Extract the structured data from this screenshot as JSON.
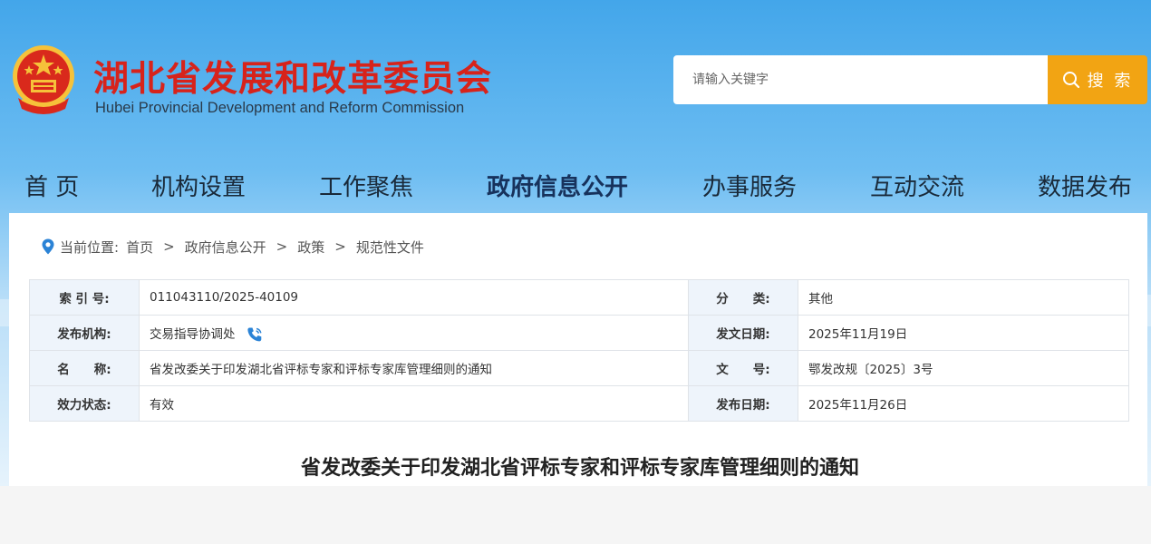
{
  "header": {
    "title_cn": "湖北省发展和改革委员会",
    "title_en": "Hubei Provincial Development and Reform Commission",
    "emblem_icon": "national-emblem-icon"
  },
  "search": {
    "placeholder": "请输入关键字",
    "button_label": "搜 索",
    "button_color": "#f2a413"
  },
  "nav": {
    "items": [
      {
        "label": "首 页"
      },
      {
        "label": "机构设置"
      },
      {
        "label": "工作聚焦"
      },
      {
        "label": "政府信息公开",
        "active": true
      },
      {
        "label": "办事服务"
      },
      {
        "label": "互动交流"
      },
      {
        "label": "数据发布"
      }
    ]
  },
  "breadcrumb": {
    "icon": "location-pin-icon",
    "prefix": "当前位置:",
    "items": [
      "首页",
      "政府信息公开",
      "政策",
      "规范性文件"
    ],
    "separator": ">"
  },
  "info": {
    "rows": [
      {
        "label1": "索 引 号:",
        "value1": "011043110/2025-40109",
        "label2": "分　　类:",
        "value2": "其他"
      },
      {
        "label1": "发布机构:",
        "value1": "交易指导协调处",
        "label2": "发文日期:",
        "value2": "2025年11月19日"
      },
      {
        "label1": "名　　称:",
        "value1": "省发改委关于印发湖北省评标专家和评标专家库管理细则的通知",
        "label2": "文　　号:",
        "value2": "鄂发改规〔2025〕3号"
      },
      {
        "label1": "效力状态:",
        "value1": "有效",
        "label2": "发布日期:",
        "value2": "2025年11月26日"
      }
    ]
  },
  "document": {
    "title": "省发改委关于印发湖北省评标专家和评标专家库管理细则的通知"
  },
  "colors": {
    "title_red": "#d7231b",
    "label_bg": "#eef4fb",
    "accent_blue": "#2b83d6"
  }
}
